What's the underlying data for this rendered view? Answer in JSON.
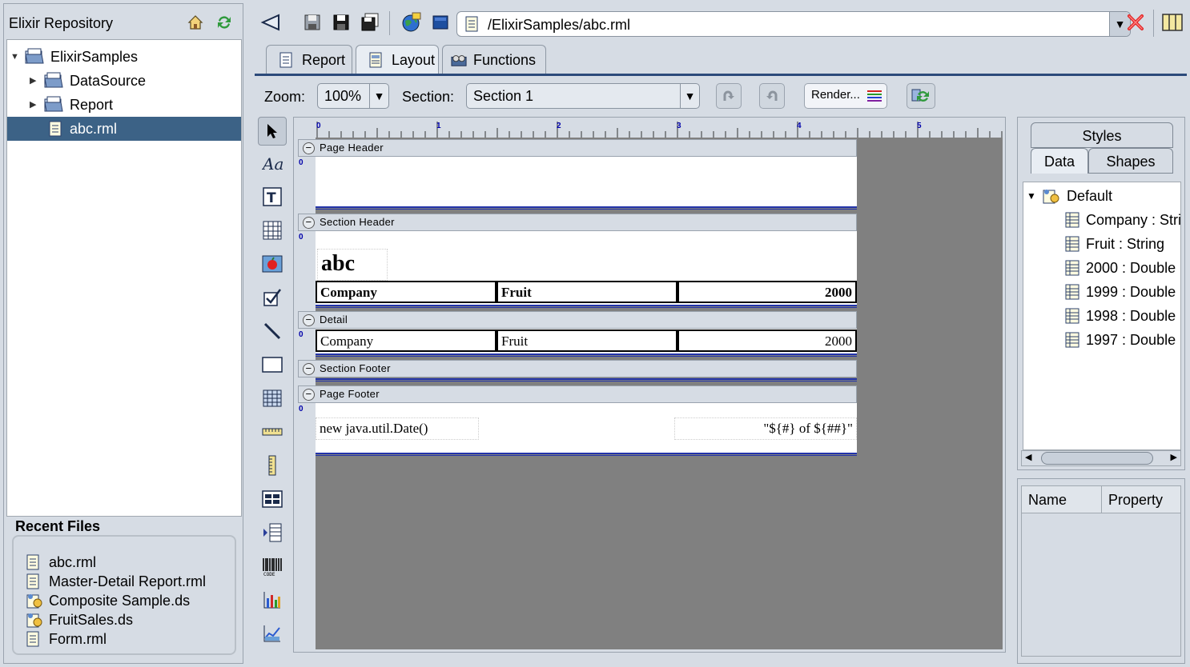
{
  "repository": {
    "title": "Elixir Repository",
    "tree": [
      {
        "label": "ElixirSamples",
        "expanded": true
      },
      {
        "label": "DataSource",
        "expanded": false
      },
      {
        "label": "Report",
        "expanded": false
      },
      {
        "label": "abc.rml",
        "selected": true
      }
    ]
  },
  "recent": {
    "title": "Recent Files",
    "items": [
      "abc.rml",
      "Master-Detail Report.rml",
      "Composite Sample.ds",
      "FruitSales.ds",
      "Form.rml"
    ]
  },
  "toolbar": {
    "path": "/ElixirSamples/abc.rml"
  },
  "tabs": [
    "Report",
    "Layout",
    "Functions"
  ],
  "active_tab": "Layout",
  "zoombar": {
    "zoom_label": "Zoom:",
    "zoom_value": "100%",
    "section_label": "Section:",
    "section_value": "Section 1",
    "render_label": "Render..."
  },
  "ruler": {
    "top_numbers": [
      "0",
      "1",
      "2",
      "3",
      "4",
      "5"
    ],
    "left_number": "0"
  },
  "layout": {
    "bands": {
      "page_header": "Page Header",
      "section_header": "Section Header",
      "detail": "Detail",
      "section_footer": "Section Footer",
      "page_footer": "Page Footer"
    },
    "section_header_title": "abc",
    "header_cells": [
      "Company",
      "Fruit",
      "2000"
    ],
    "detail_cells": [
      "Company",
      "Fruit",
      "2000"
    ],
    "footer_left": "new java.util.Date()",
    "footer_right": "\"${#} of ${##}\""
  },
  "right_panel": {
    "tabs_top": [
      "Styles"
    ],
    "tabs_bottom": [
      "Data",
      "Shapes"
    ],
    "active_tab": "Data",
    "tree_root": "Default",
    "fields": [
      "Company : String",
      "Fruit : String",
      "2000 : Double",
      "1999 : Double",
      "1998 : Double",
      "1997 : Double"
    ],
    "property_headers": [
      "Name",
      "Property"
    ]
  },
  "colors": {
    "selection": "#3c6286",
    "band_separator": "#2233aa",
    "canvas_gray": "#808080",
    "panel_bg": "#d6dce4"
  }
}
